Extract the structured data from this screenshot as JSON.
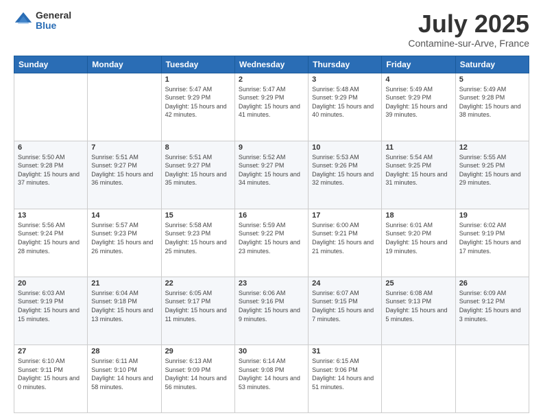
{
  "header": {
    "logo": {
      "general": "General",
      "blue": "Blue"
    },
    "title": "July 2025",
    "subtitle": "Contamine-sur-Arve, France"
  },
  "weekdays": [
    "Sunday",
    "Monday",
    "Tuesday",
    "Wednesday",
    "Thursday",
    "Friday",
    "Saturday"
  ],
  "weeks": [
    [
      {
        "day": "",
        "info": ""
      },
      {
        "day": "",
        "info": ""
      },
      {
        "day": "1",
        "info": "Sunrise: 5:47 AM\nSunset: 9:29 PM\nDaylight: 15 hours and 42 minutes."
      },
      {
        "day": "2",
        "info": "Sunrise: 5:47 AM\nSunset: 9:29 PM\nDaylight: 15 hours and 41 minutes."
      },
      {
        "day": "3",
        "info": "Sunrise: 5:48 AM\nSunset: 9:29 PM\nDaylight: 15 hours and 40 minutes."
      },
      {
        "day": "4",
        "info": "Sunrise: 5:49 AM\nSunset: 9:29 PM\nDaylight: 15 hours and 39 minutes."
      },
      {
        "day": "5",
        "info": "Sunrise: 5:49 AM\nSunset: 9:28 PM\nDaylight: 15 hours and 38 minutes."
      }
    ],
    [
      {
        "day": "6",
        "info": "Sunrise: 5:50 AM\nSunset: 9:28 PM\nDaylight: 15 hours and 37 minutes."
      },
      {
        "day": "7",
        "info": "Sunrise: 5:51 AM\nSunset: 9:27 PM\nDaylight: 15 hours and 36 minutes."
      },
      {
        "day": "8",
        "info": "Sunrise: 5:51 AM\nSunset: 9:27 PM\nDaylight: 15 hours and 35 minutes."
      },
      {
        "day": "9",
        "info": "Sunrise: 5:52 AM\nSunset: 9:27 PM\nDaylight: 15 hours and 34 minutes."
      },
      {
        "day": "10",
        "info": "Sunrise: 5:53 AM\nSunset: 9:26 PM\nDaylight: 15 hours and 32 minutes."
      },
      {
        "day": "11",
        "info": "Sunrise: 5:54 AM\nSunset: 9:25 PM\nDaylight: 15 hours and 31 minutes."
      },
      {
        "day": "12",
        "info": "Sunrise: 5:55 AM\nSunset: 9:25 PM\nDaylight: 15 hours and 29 minutes."
      }
    ],
    [
      {
        "day": "13",
        "info": "Sunrise: 5:56 AM\nSunset: 9:24 PM\nDaylight: 15 hours and 28 minutes."
      },
      {
        "day": "14",
        "info": "Sunrise: 5:57 AM\nSunset: 9:23 PM\nDaylight: 15 hours and 26 minutes."
      },
      {
        "day": "15",
        "info": "Sunrise: 5:58 AM\nSunset: 9:23 PM\nDaylight: 15 hours and 25 minutes."
      },
      {
        "day": "16",
        "info": "Sunrise: 5:59 AM\nSunset: 9:22 PM\nDaylight: 15 hours and 23 minutes."
      },
      {
        "day": "17",
        "info": "Sunrise: 6:00 AM\nSunset: 9:21 PM\nDaylight: 15 hours and 21 minutes."
      },
      {
        "day": "18",
        "info": "Sunrise: 6:01 AM\nSunset: 9:20 PM\nDaylight: 15 hours and 19 minutes."
      },
      {
        "day": "19",
        "info": "Sunrise: 6:02 AM\nSunset: 9:19 PM\nDaylight: 15 hours and 17 minutes."
      }
    ],
    [
      {
        "day": "20",
        "info": "Sunrise: 6:03 AM\nSunset: 9:19 PM\nDaylight: 15 hours and 15 minutes."
      },
      {
        "day": "21",
        "info": "Sunrise: 6:04 AM\nSunset: 9:18 PM\nDaylight: 15 hours and 13 minutes."
      },
      {
        "day": "22",
        "info": "Sunrise: 6:05 AM\nSunset: 9:17 PM\nDaylight: 15 hours and 11 minutes."
      },
      {
        "day": "23",
        "info": "Sunrise: 6:06 AM\nSunset: 9:16 PM\nDaylight: 15 hours and 9 minutes."
      },
      {
        "day": "24",
        "info": "Sunrise: 6:07 AM\nSunset: 9:15 PM\nDaylight: 15 hours and 7 minutes."
      },
      {
        "day": "25",
        "info": "Sunrise: 6:08 AM\nSunset: 9:13 PM\nDaylight: 15 hours and 5 minutes."
      },
      {
        "day": "26",
        "info": "Sunrise: 6:09 AM\nSunset: 9:12 PM\nDaylight: 15 hours and 3 minutes."
      }
    ],
    [
      {
        "day": "27",
        "info": "Sunrise: 6:10 AM\nSunset: 9:11 PM\nDaylight: 15 hours and 0 minutes."
      },
      {
        "day": "28",
        "info": "Sunrise: 6:11 AM\nSunset: 9:10 PM\nDaylight: 14 hours and 58 minutes."
      },
      {
        "day": "29",
        "info": "Sunrise: 6:13 AM\nSunset: 9:09 PM\nDaylight: 14 hours and 56 minutes."
      },
      {
        "day": "30",
        "info": "Sunrise: 6:14 AM\nSunset: 9:08 PM\nDaylight: 14 hours and 53 minutes."
      },
      {
        "day": "31",
        "info": "Sunrise: 6:15 AM\nSunset: 9:06 PM\nDaylight: 14 hours and 51 minutes."
      },
      {
        "day": "",
        "info": ""
      },
      {
        "day": "",
        "info": ""
      }
    ]
  ]
}
